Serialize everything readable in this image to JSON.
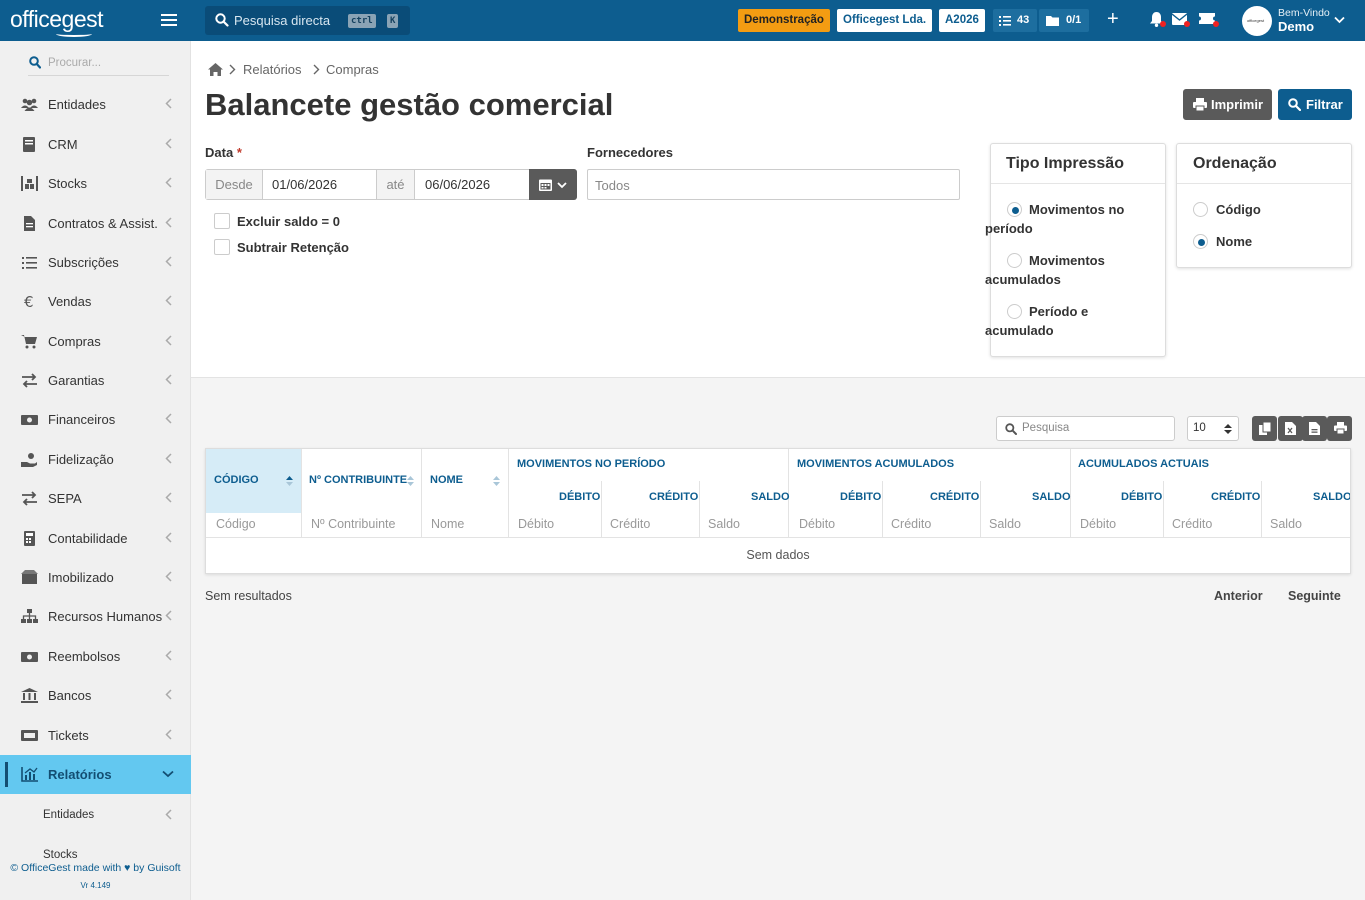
{
  "app": {
    "logo": "officegest",
    "search_placeholder": "Pesquisa directa",
    "search_kbd_1": "ctrl",
    "search_kbd_2": "K",
    "badge_demo": "Demonstração",
    "company": "Officegest Lda.",
    "year": "A2026",
    "tasks_count": "43",
    "docs_count": "0/1",
    "avatar_text": "officegest",
    "welcome": "Bem-Vindo",
    "username": "Demo",
    "accent": "#0d5d8f",
    "active_bg": "#63c8f0"
  },
  "sidebar": {
    "search_placeholder": "Procurar...",
    "items": [
      {
        "label": "Entidades",
        "icon": "users-icon"
      },
      {
        "label": "CRM",
        "icon": "book-icon"
      },
      {
        "label": "Stocks",
        "icon": "warehouse-icon"
      },
      {
        "label": "Contratos & Assist.",
        "icon": "contract-icon"
      },
      {
        "label": "Subscrições",
        "icon": "list-icon"
      },
      {
        "label": "Vendas",
        "icon": "euro-icon"
      },
      {
        "label": "Compras",
        "icon": "cart-icon"
      },
      {
        "label": "Garantias",
        "icon": "exchange-icon"
      },
      {
        "label": "Financeiros",
        "icon": "money-icon"
      },
      {
        "label": "Fidelização",
        "icon": "hand-coin-icon"
      },
      {
        "label": "SEPA",
        "icon": "exchange-icon"
      },
      {
        "label": "Contabilidade",
        "icon": "calculator-icon"
      },
      {
        "label": "Imobilizado",
        "icon": "box-icon"
      },
      {
        "label": "Recursos Humanos",
        "icon": "org-chart-icon"
      },
      {
        "label": "Reembolsos",
        "icon": "money-icon"
      },
      {
        "label": "Bancos",
        "icon": "bank-icon"
      },
      {
        "label": "Tickets",
        "icon": "ticket-icon"
      },
      {
        "label": "Relatórios",
        "icon": "chart-icon"
      }
    ],
    "subitems": [
      {
        "label": "Entidades"
      },
      {
        "label": "Stocks"
      }
    ],
    "footer": "© OfficeGest made with ♥ by Guisoft",
    "version": "Vr 4.149"
  },
  "page": {
    "breadcrumb": [
      "Relatórios",
      "Compras"
    ],
    "title": "Balancete gestão comercial",
    "btn_print": "Imprimir",
    "btn_filter": "Filtrar"
  },
  "form": {
    "date_label": "Data",
    "required_mark": "*",
    "from_label": "Desde",
    "from_value": "01/06/2026",
    "to_label": "até",
    "to_value": "06/06/2026",
    "suppliers_label": "Fornecedores",
    "suppliers_placeholder": "Todos",
    "check_exclude": "Excluir saldo = 0",
    "check_subtract": "Subtrair Retenção"
  },
  "print_type": {
    "title": "Tipo Impressão",
    "options": [
      {
        "label": "Movimentos no período",
        "line1": "Movimentos no",
        "line2": "período",
        "selected": true
      },
      {
        "label": "Movimentos acumulados",
        "line1": "Movimentos",
        "line2": "acumulados",
        "selected": false
      },
      {
        "label": "Período e acumulado",
        "line1": "Período e",
        "line2": "acumulado",
        "selected": false
      }
    ]
  },
  "ordering": {
    "title": "Ordenação",
    "options": [
      {
        "label": "Código",
        "selected": false
      },
      {
        "label": "Nome",
        "selected": true
      }
    ]
  },
  "table": {
    "search_placeholder": "Pesquisa",
    "page_size": "10",
    "columns": {
      "code": "CÓDIGO",
      "nif": "Nº CONTRIBUINTE",
      "name": "NOME",
      "group_period": "MOVIMENTOS NO PERÍODO",
      "group_acc": "MOVIMENTOS ACUMULADOS",
      "group_current": "ACUMULADOS ACTUAIS",
      "debit": "DÉBITO",
      "credit": "CRÉDITO",
      "balance": "SALDO"
    },
    "filters": {
      "code": "Código",
      "nif": "Nº Contribuinte",
      "name": "Nome",
      "debit": "Débito",
      "credit": "Crédito",
      "balance": "Saldo"
    },
    "empty": "Sem dados",
    "no_results": "Sem resultados",
    "prev": "Anterior",
    "next": "Seguinte"
  }
}
